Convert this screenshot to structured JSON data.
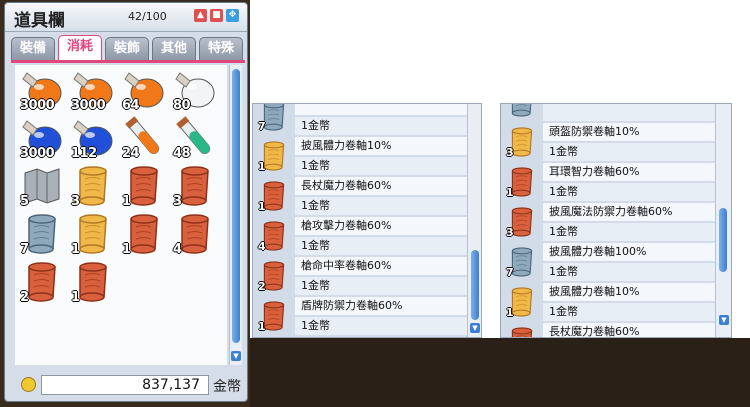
{
  "inventory": {
    "title": "道具欄",
    "count": "42/100",
    "tabs": [
      "裝備",
      "消耗",
      "裝飾",
      "其他",
      "特殊"
    ],
    "active_tab": "消耗",
    "items": [
      {
        "kind": "potion-orange",
        "qty": "3000"
      },
      {
        "kind": "potion-orange",
        "qty": "3000"
      },
      {
        "kind": "potion-orange",
        "qty": "64"
      },
      {
        "kind": "potion-white",
        "qty": "80"
      },
      {
        "kind": "potion-blue",
        "qty": "3000"
      },
      {
        "kind": "potion-blue",
        "qty": "112"
      },
      {
        "kind": "vial-orange",
        "qty": "24"
      },
      {
        "kind": "vial-green",
        "qty": "48"
      },
      {
        "kind": "map",
        "qty": "5"
      },
      {
        "kind": "scroll-gold",
        "qty": "3"
      },
      {
        "kind": "scroll-red",
        "qty": "1"
      },
      {
        "kind": "scroll-red",
        "qty": "3"
      },
      {
        "kind": "scroll-blue",
        "qty": "7"
      },
      {
        "kind": "scroll-gold",
        "qty": "1"
      },
      {
        "kind": "scroll-red",
        "qty": "1"
      },
      {
        "kind": "scroll-red",
        "qty": "4"
      },
      {
        "kind": "scroll-red",
        "qty": "2"
      },
      {
        "kind": "scroll-red",
        "qty": "1"
      }
    ],
    "meso": "837,137",
    "meso_unit": "金幣"
  },
  "shop_left": {
    "rows": [
      {
        "name": "",
        "price": "1金幣",
        "icon": "scroll-blue",
        "qty": "7"
      },
      {
        "name": "披風體力卷軸10%",
        "price": "1金幣",
        "icon": "scroll-gold",
        "qty": "1"
      },
      {
        "name": "長杖魔力卷軸60%",
        "price": "1金幣",
        "icon": "scroll-red",
        "qty": "1"
      },
      {
        "name": "槍攻擊力卷軸60%",
        "price": "1金幣",
        "icon": "scroll-red",
        "qty": "4"
      },
      {
        "name": "槍命中率卷軸60%",
        "price": "1金幣",
        "icon": "scroll-red",
        "qty": "2"
      },
      {
        "name": "盾牌防禦力卷軸60%",
        "price": "1金幣",
        "icon": "scroll-red",
        "qty": "1"
      }
    ]
  },
  "shop_right": {
    "rows": [
      {
        "name": "",
        "price": "",
        "icon": "scroll-blue",
        "qty": ""
      },
      {
        "name": "頭盔防禦卷軸10%",
        "price": "1金幣",
        "icon": "scroll-gold",
        "qty": "3"
      },
      {
        "name": "耳環智力卷軸60%",
        "price": "1金幣",
        "icon": "scroll-red",
        "qty": "1"
      },
      {
        "name": "披風魔法防禦力卷軸60%",
        "price": "1金幣",
        "icon": "scroll-red",
        "qty": "3"
      },
      {
        "name": "披風體力卷軸100%",
        "price": "1金幣",
        "icon": "scroll-blue",
        "qty": "7"
      },
      {
        "name": "披風體力卷軸10%",
        "price": "1金幣",
        "icon": "scroll-gold",
        "qty": "1"
      },
      {
        "name": "長杖魔力卷軸60%",
        "price": "",
        "icon": "scroll-red",
        "qty": ""
      }
    ]
  },
  "colors": {
    "accent": "#e0477f",
    "scroll_thumb": "#3b7fd0"
  }
}
